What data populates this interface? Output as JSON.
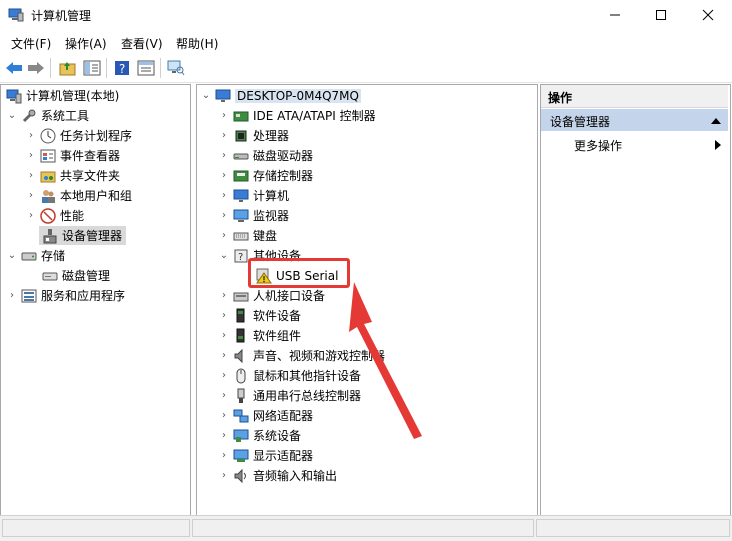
{
  "window": {
    "title": "计算机管理"
  },
  "menu": [
    "文件(F)",
    "操作(A)",
    "查看(V)",
    "帮助(H)"
  ],
  "left_tree": {
    "root": "计算机管理(本地)",
    "system_tools": "系统工具",
    "items": [
      "任务计划程序",
      "事件查看器",
      "共享文件夹",
      "本地用户和组",
      "性能",
      "设备管理器"
    ],
    "storage": "存储",
    "disk_mgmt": "磁盘管理",
    "services": "服务和应用程序"
  },
  "device_tree": {
    "computer": "DESKTOP-0M4Q7MQ",
    "categories": [
      "IDE ATA/ATAPI 控制器",
      "处理器",
      "磁盘驱动器",
      "存储控制器",
      "计算机",
      "监视器",
      "键盘",
      "其他设备"
    ],
    "other_child": "USB Serial",
    "more_categories": [
      "人机接口设备",
      "软件设备",
      "软件组件",
      "声音、视频和游戏控制器",
      "鼠标和其他指针设备",
      "通用串行总线控制器",
      "网络适配器",
      "系统设备",
      "显示适配器",
      "音频输入和输出"
    ]
  },
  "actions": {
    "header": "操作",
    "section": "设备管理器",
    "more": "更多操作"
  },
  "colors": {
    "accent": "#e53935",
    "selection": "#c4d4ea"
  }
}
